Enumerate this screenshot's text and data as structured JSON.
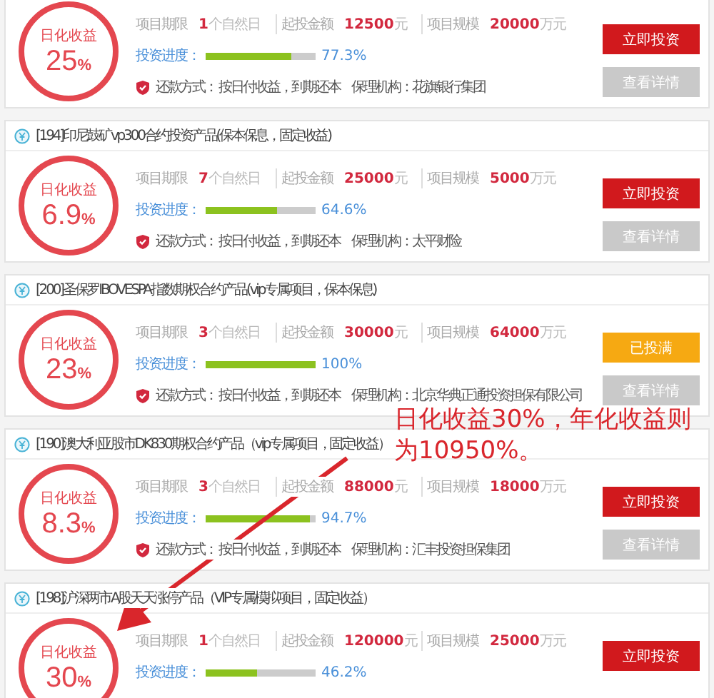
{
  "cards": [
    {
      "rate_label": "日化收益",
      "rate": "25",
      "unit": "%",
      "term_label": "项目期限",
      "term_value": "1",
      "term_unit": "个自然日",
      "min_label": "起投金额",
      "min_value": "12500",
      "min_unit": "元",
      "scale_label": "项目规模",
      "scale_value": "20000",
      "scale_unit": "万元",
      "progress_label": "投资进度：",
      "level": 0.773,
      "progress_text": "77.3%",
      "repay": "还款方式： 按日付收益，到期还本",
      "guarantor": "保理机构：花旗银行集团",
      "action": {
        "label": "立即投资",
        "kind": "invest"
      },
      "details": "查看详情"
    },
    {
      "title": "[194]印尼鼓矿vp300合约投资产品(保本保息，固定收益)",
      "rate_label": "日化收益",
      "rate": "6.9",
      "unit": "%",
      "term_label": "项目期限",
      "term_value": "7",
      "term_unit": "个自然日",
      "min_label": "起投金额",
      "min_value": "25000",
      "min_unit": "元",
      "scale_label": "项目规模",
      "scale_value": "5000",
      "scale_unit": "万元",
      "progress_label": "投资进度：",
      "level": 0.646,
      "progress_text": "64.6%",
      "repay": "还款方式： 按日付收益，到期还本",
      "guarantor": "保理机构：太平财险",
      "action": {
        "label": "立即投资",
        "kind": "invest"
      },
      "details": "查看详情"
    },
    {
      "title": "[200]圣保罗IBOVESPA指数期权合约产品(vip专属项目，保本保息)",
      "rate_label": "日化收益",
      "rate": "23",
      "unit": "%",
      "term_label": "项目期限",
      "term_value": "3",
      "term_unit": "个自然日",
      "min_label": "起投金额",
      "min_value": "30000",
      "min_unit": "元",
      "scale_label": "项目规模",
      "scale_value": "64000",
      "scale_unit": "万元",
      "progress_label": "投资进度：",
      "level": 1,
      "progress_text": "100%",
      "repay": "还款方式： 按日付收益，到期还本",
      "guarantor": "保理机构：北京华典正通投资担保有限公司",
      "action": {
        "label": "已投满",
        "kind": "full"
      },
      "details": "查看详情"
    },
    {
      "title": "[190]澳大利亚股市DK830期权合约产品（vip专属项目，固定收益）",
      "rate_label": "日化收益",
      "rate": "8.3",
      "unit": "%",
      "term_label": "项目期限",
      "term_value": "3",
      "term_unit": "个自然日",
      "min_label": "起投金额",
      "min_value": "88000",
      "min_unit": "元",
      "scale_label": "项目规模",
      "scale_value": "18000",
      "scale_unit": "万元",
      "progress_label": "投资进度：",
      "level": 0.947,
      "progress_text": "94.7%",
      "repay": "还款方式： 按日付收益，到期还本",
      "guarantor": "保理机构：汇丰投资担保集团",
      "action": {
        "label": "立即投资",
        "kind": "invest"
      },
      "details": "查看详情"
    },
    {
      "title": "[198]沪深两市A股天天涨停产品（VIP专属模拟项目，固定收益）",
      "rate_label": "日化收益",
      "rate": "30",
      "unit": "%",
      "term_label": "项目期限",
      "term_value": "1",
      "term_unit": "个自然日",
      "min_label": "起投金额",
      "min_value": "120000",
      "min_unit": "元",
      "scale_label": "项目规模",
      "scale_value": "25000",
      "scale_unit": "万元",
      "progress_label": "投资进度：",
      "level": 0.462,
      "progress_text": "46.2%",
      "action": {
        "label": "立即投资",
        "kind": "invest"
      }
    }
  ],
  "annotation": {
    "text": "日化收益30%，年化收益则为10950%。"
  }
}
